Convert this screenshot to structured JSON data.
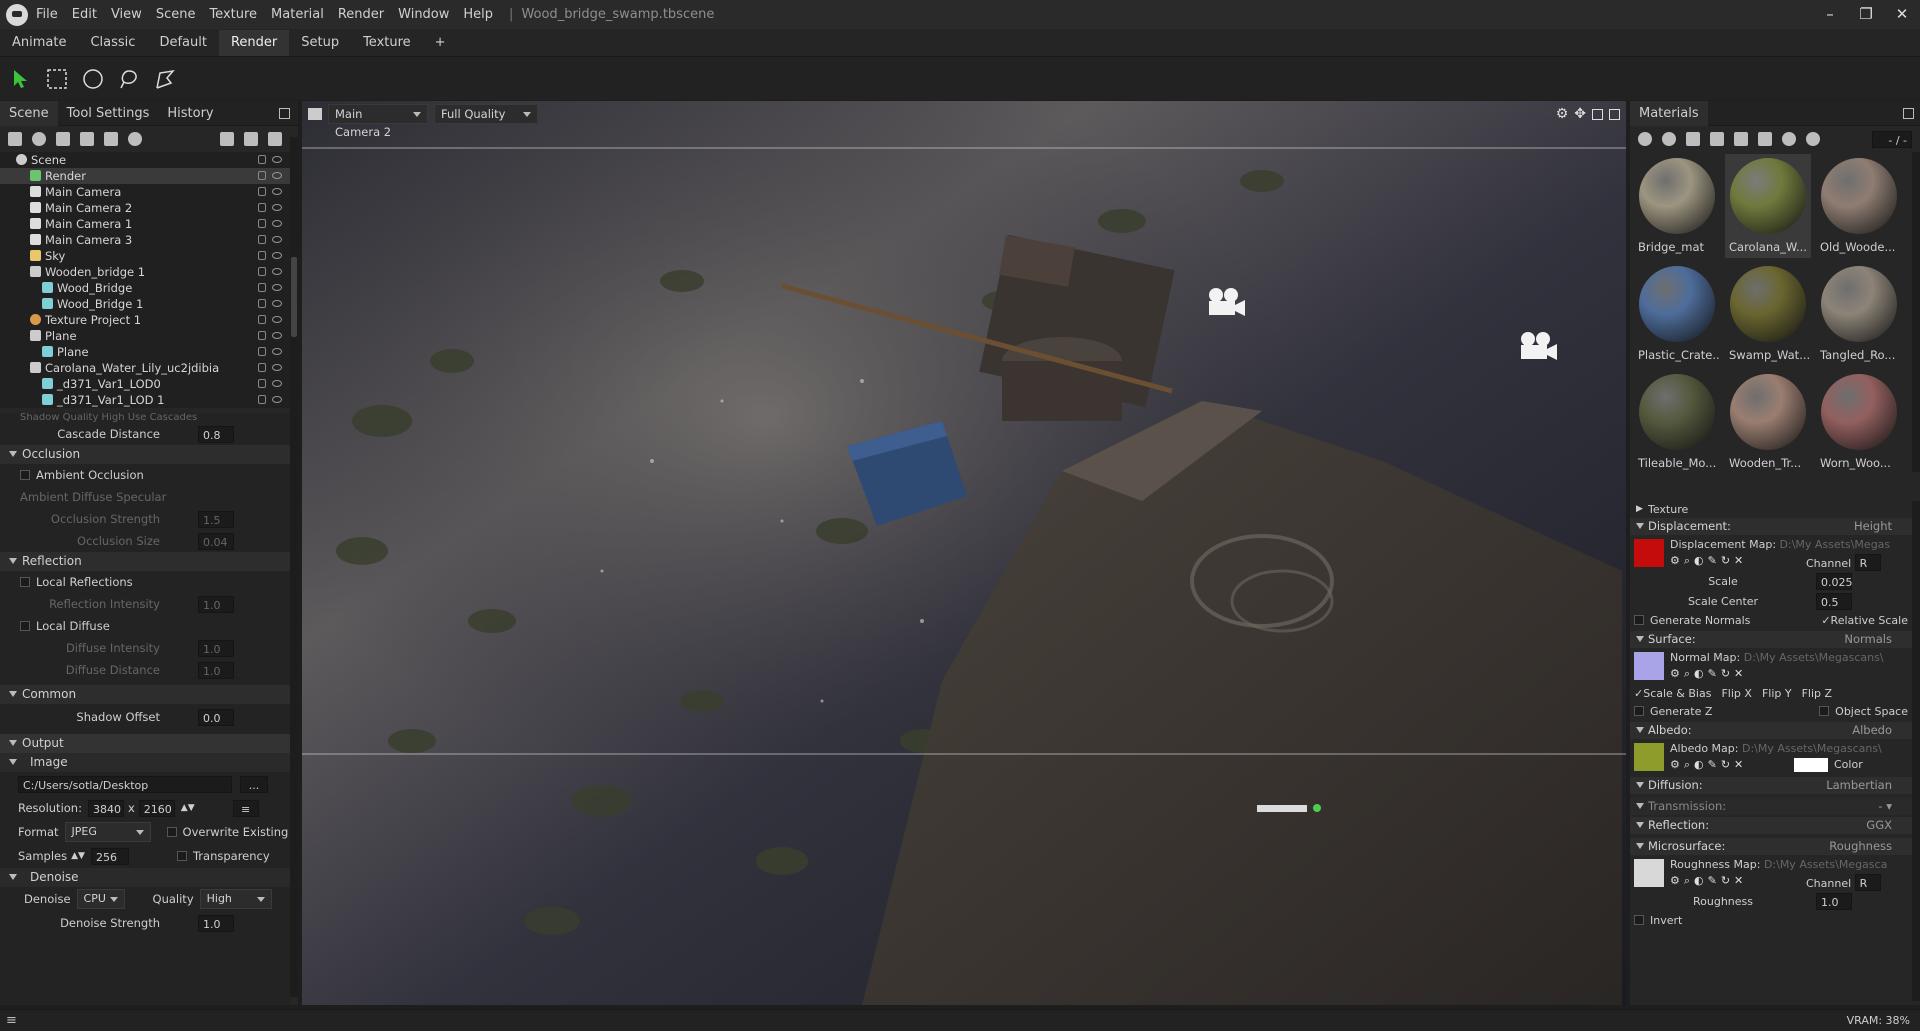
{
  "titlebar": {
    "menu": [
      "File",
      "Edit",
      "View",
      "Scene",
      "Texture",
      "Material",
      "Render",
      "Window",
      "Help"
    ],
    "document": "Wood_bridge_swamp.tbscene"
  },
  "layout_tabs": [
    "Animate",
    "Classic",
    "Default",
    "Render",
    "Setup",
    "Texture",
    "+"
  ],
  "left": {
    "tabs": [
      "Scene",
      "Tool Settings",
      "History"
    ],
    "tree": [
      {
        "label": "Scene"
      },
      {
        "label": "Render"
      },
      {
        "label": "Main Camera"
      },
      {
        "label": "Main Camera 2"
      },
      {
        "label": "Main Camera 1"
      },
      {
        "label": "Main Camera 3"
      },
      {
        "label": "Sky"
      },
      {
        "label": "Wooden_bridge 1"
      },
      {
        "label": "Wood_Bridge"
      },
      {
        "label": "Wood_Bridge 1"
      },
      {
        "label": "Texture Project 1"
      },
      {
        "label": "Plane"
      },
      {
        "label": "Plane"
      },
      {
        "label": "Carolana_Water_Lily_uc2jdibia"
      },
      {
        "label": "_d371_Var1_LOD0"
      },
      {
        "label": "_d371_Var1_LOD 1"
      }
    ],
    "props": {
      "cut_top": "Shadow Quality    High        Use Cascades",
      "cascade_distance": {
        "label": "Cascade Distance",
        "value": "0.8"
      },
      "occlusion": "Occlusion",
      "ambient_occlusion": "Ambient Occlusion",
      "ambient_row": "Ambient  Diffuse  Specular",
      "occ_strength": {
        "label": "Occlusion Strength",
        "value": "1.5"
      },
      "occ_size": {
        "label": "Occlusion Size",
        "value": "0.04"
      },
      "reflection": "Reflection",
      "local_reflections": "Local Reflections",
      "refl_intensity": {
        "label": "Reflection Intensity",
        "value": "1.0"
      },
      "local_diffuse": "Local Diffuse",
      "diff_intensity": {
        "label": "Diffuse Intensity",
        "value": "1.0"
      },
      "diff_distance": {
        "label": "Diffuse Distance",
        "value": "1.0"
      },
      "common": "Common",
      "shadow_offset": {
        "label": "Shadow Offset",
        "value": "0.0"
      },
      "output": "Output",
      "image": "Image",
      "path": "C:/Users/sotla/Desktop",
      "browse": "...",
      "resolution_label": "Resolution:",
      "res_w": "3840",
      "res_x": "x",
      "res_h": "2160",
      "format_label": "Format",
      "format": "JPEG",
      "overwrite": "Overwrite Existing",
      "samples_label": "Samples",
      "samples": "256",
      "transparency": "Transparency",
      "denoise_section": "Denoise",
      "denoise_label": "Denoise",
      "denoise": "CPU",
      "quality_label": "Quality",
      "quality": "High",
      "denoise_strength": {
        "label": "Denoise Strength",
        "value": "1.0"
      }
    }
  },
  "viewport": {
    "camera": "Main Camera 2",
    "quality": "Full Quality"
  },
  "right": {
    "title": "Materials",
    "page": "- / -",
    "materials": [
      {
        "label": "Bridge_mat",
        "color": "#9c9580"
      },
      {
        "label": "Carolana_W...",
        "color": "#6f7a3c"
      },
      {
        "label": "Old_Woode...",
        "color": "#8f7d72"
      },
      {
        "label": "Plastic_Crate...",
        "color": "#4e6d9b"
      },
      {
        "label": "Swamp_Wat...",
        "color": "#6a6630"
      },
      {
        "label": "Tangled_Ro...",
        "color": "#8d8478"
      },
      {
        "label": "Tileable_Mo...",
        "color": "#555a3e"
      },
      {
        "label": "Wooden_Tr...",
        "color": "#9a7e70"
      },
      {
        "label": "Worn_Woo...",
        "color": "#93605f"
      }
    ],
    "texture": "Texture",
    "displacement": {
      "title": "Displacement:",
      "mode": "Height",
      "map_label": "Displacement Map:",
      "map_path": "D:\\My Assets\\Megas",
      "channel_label": "Channel",
      "channel": "R",
      "scale_label": "Scale",
      "scale": "0.025",
      "center_label": "Scale Center",
      "center": "0.5",
      "gen_normals": "Generate Normals",
      "relative_scale": "Relative Scale",
      "swatch": "#c40c0c"
    },
    "surface": {
      "title": "Surface:",
      "mode": "Normals",
      "map_label": "Normal Map:",
      "map_path": "D:\\My Assets\\Megascans\\",
      "scale_bias": "Scale & Bias",
      "flip_x": "Flip X",
      "flip_y": "Flip Y",
      "flip_z": "Flip Z",
      "gen_z": "Generate Z",
      "object_space": "Object Space",
      "swatch": "#a9a3e8"
    },
    "albedo": {
      "title": "Albedo:",
      "mode": "Albedo",
      "map_label": "Albedo Map:",
      "map_path": "D:\\My Assets\\Megascans\\",
      "color_label": "Color",
      "swatch": "#8d9c2a"
    },
    "diffusion": {
      "title": "Diffusion:",
      "mode": "Lambertian"
    },
    "transmission": {
      "title": "Transmission:",
      "mode": "- ▾"
    },
    "reflection": {
      "title": "Reflection:",
      "mode": "GGX"
    },
    "microsurface": {
      "title": "Microsurface:",
      "mode": "Roughness",
      "map_label": "Roughness Map:",
      "map_path": "D:\\My Assets\\Megasca",
      "channel_label": "Channel",
      "channel": "R",
      "roughness_label": "Roughness",
      "roughness": "1.0",
      "invert": "Invert",
      "swatch": "#d8d8d8"
    }
  },
  "status": {
    "vram": "VRAM: 38%"
  }
}
